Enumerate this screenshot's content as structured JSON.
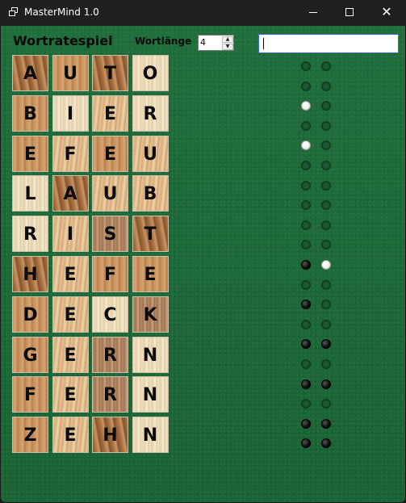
{
  "window": {
    "title": "MasterMind 1.0",
    "close_glyph": "✕"
  },
  "header": {
    "heading": "Wortratespiel",
    "length_label": "Wortlänge",
    "length_value": "4",
    "guess_value": ""
  },
  "board": {
    "rows": [
      {
        "letters": [
          "A",
          "U",
          "T",
          "O"
        ],
        "feedback": [
          "empty",
          "empty"
        ]
      },
      {
        "letters": [
          "B",
          "I",
          "E",
          "R"
        ],
        "feedback": [
          "empty",
          "empty"
        ]
      },
      {
        "letters": [
          "E",
          "F",
          "E",
          "U"
        ],
        "feedback": [
          "white",
          "empty"
        ]
      },
      {
        "letters": [
          "L",
          "A",
          "U",
          "B"
        ],
        "feedback": [
          "empty",
          "empty"
        ]
      },
      {
        "letters": [
          "R",
          "I",
          "S",
          "T"
        ],
        "feedback": [
          "white",
          "empty"
        ]
      },
      {
        "letters": [
          "H",
          "E",
          "F",
          "E"
        ],
        "feedback": [
          "empty",
          "empty"
        ]
      },
      {
        "letters": [
          "D",
          "E",
          "C",
          "K"
        ],
        "feedback": [
          "empty",
          "empty"
        ]
      },
      {
        "letters": [
          "G",
          "E",
          "R",
          "N"
        ],
        "feedback": [
          "empty",
          "empty"
        ]
      },
      {
        "letters": [
          "F",
          "E",
          "R",
          "N"
        ],
        "feedback": [
          "empty",
          "empty"
        ]
      },
      {
        "letters": [
          "Z",
          "E",
          "H",
          "N"
        ],
        "feedback": [
          "empty",
          "empty"
        ]
      }
    ],
    "pegs": [
      [
        "empty",
        "empty"
      ],
      [
        "empty",
        "empty"
      ],
      [
        "white",
        "empty"
      ],
      [
        "empty",
        "empty"
      ],
      [
        "white",
        "empty"
      ],
      [
        "empty",
        "empty"
      ],
      [
        "empty",
        "empty"
      ],
      [
        "empty",
        "empty"
      ],
      [
        "empty",
        "empty"
      ],
      [
        "empty",
        "empty"
      ],
      [
        "black",
        "white"
      ],
      [
        "empty",
        "empty"
      ],
      [
        "black",
        "empty"
      ],
      [
        "empty",
        "empty"
      ],
      [
        "black",
        "black"
      ],
      [
        "empty",
        "empty"
      ],
      [
        "black",
        "black"
      ],
      [
        "empty",
        "empty"
      ],
      [
        "black",
        "black"
      ],
      [
        "black",
        "black"
      ]
    ]
  },
  "colors": {
    "felt": "#1e6a3a",
    "titlebar": "#1f1f1f"
  }
}
